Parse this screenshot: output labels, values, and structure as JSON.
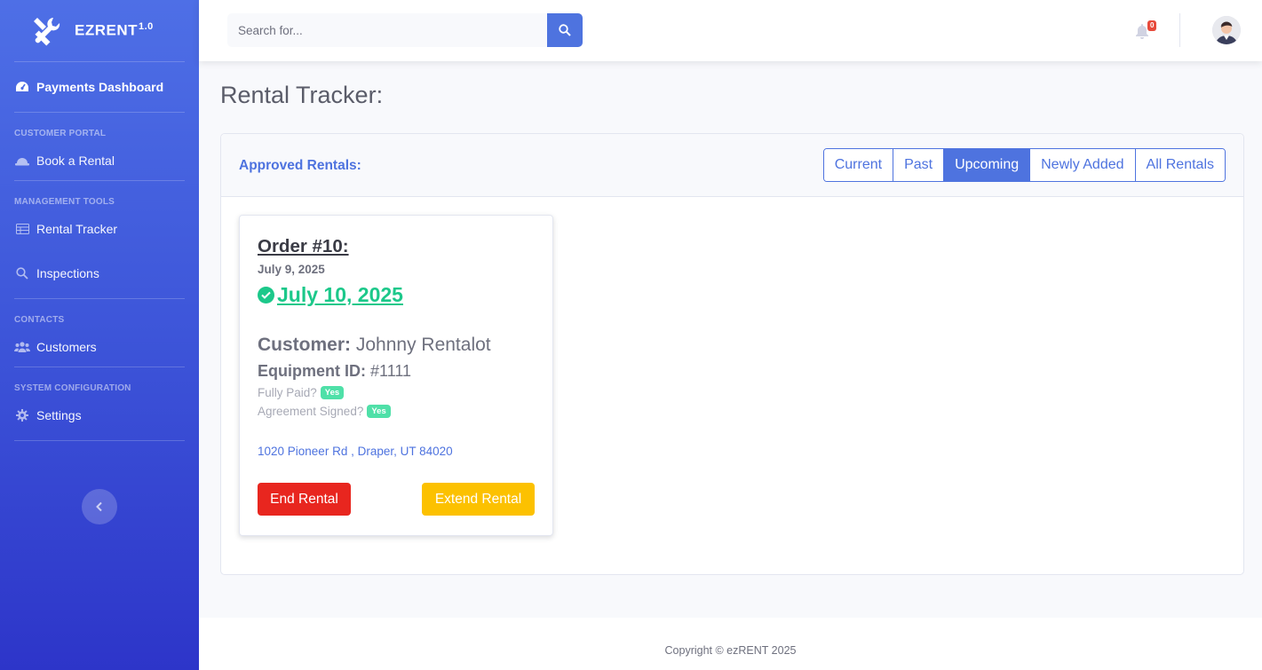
{
  "brand": {
    "name": "EZRENT",
    "version": "1.0",
    "icon": "tools-icon"
  },
  "sidebar": {
    "dashboard": {
      "label": "Payments Dashboard",
      "icon": "tachometer-icon"
    },
    "sections": [
      {
        "heading": "CUSTOMER PORTAL",
        "items": [
          {
            "label": "Book a Rental",
            "icon": "hard-hat-icon"
          }
        ]
      },
      {
        "heading": "MANAGEMENT TOOLS",
        "items": [
          {
            "label": "Rental Tracker",
            "icon": "table-icon"
          },
          {
            "label": "Inspections",
            "icon": "search-icon"
          }
        ]
      },
      {
        "heading": "CONTACTS",
        "items": [
          {
            "label": "Customers",
            "icon": "users-icon"
          }
        ]
      },
      {
        "heading": "SYSTEM CONFIGURATION",
        "items": [
          {
            "label": "Settings",
            "icon": "gear-icon"
          }
        ]
      }
    ],
    "toggle_icon": "chevron-left-icon"
  },
  "topbar": {
    "search": {
      "placeholder": "Search for...",
      "value": "",
      "button_icon": "search-icon"
    },
    "alerts": {
      "icon": "bell-icon",
      "count": "0"
    },
    "user": {
      "icon": "avatar-icon"
    }
  },
  "page": {
    "title": "Rental Tracker:",
    "card_title": "Approved Rentals:",
    "filters": [
      "Current",
      "Past",
      "Upcoming",
      "Newly Added",
      "All Rentals"
    ],
    "active_filter": "Upcoming"
  },
  "order": {
    "title": "Order #10:",
    "date": "July 9, 2025",
    "return_date": "July 10, 2025",
    "customer_label": "Customer:",
    "customer": "Johnny Rentalot",
    "equipment_label": "Equipment ID:",
    "equipment": "#1111",
    "paid_label": "Fully Paid?",
    "paid": "Yes",
    "signed_label": "Agreement Signed?",
    "signed": "Yes",
    "address": "1020 Pioneer Rd , Draper, UT 84020",
    "end_label": "End Rental",
    "extend_label": "Extend Rental"
  },
  "colors": {
    "primary": "#4e73df",
    "success": "#1cc88a",
    "danger": "#e8261f",
    "warning": "#fcc100"
  },
  "footer": {
    "copyright": "Copyright © ezRENT 2025"
  }
}
